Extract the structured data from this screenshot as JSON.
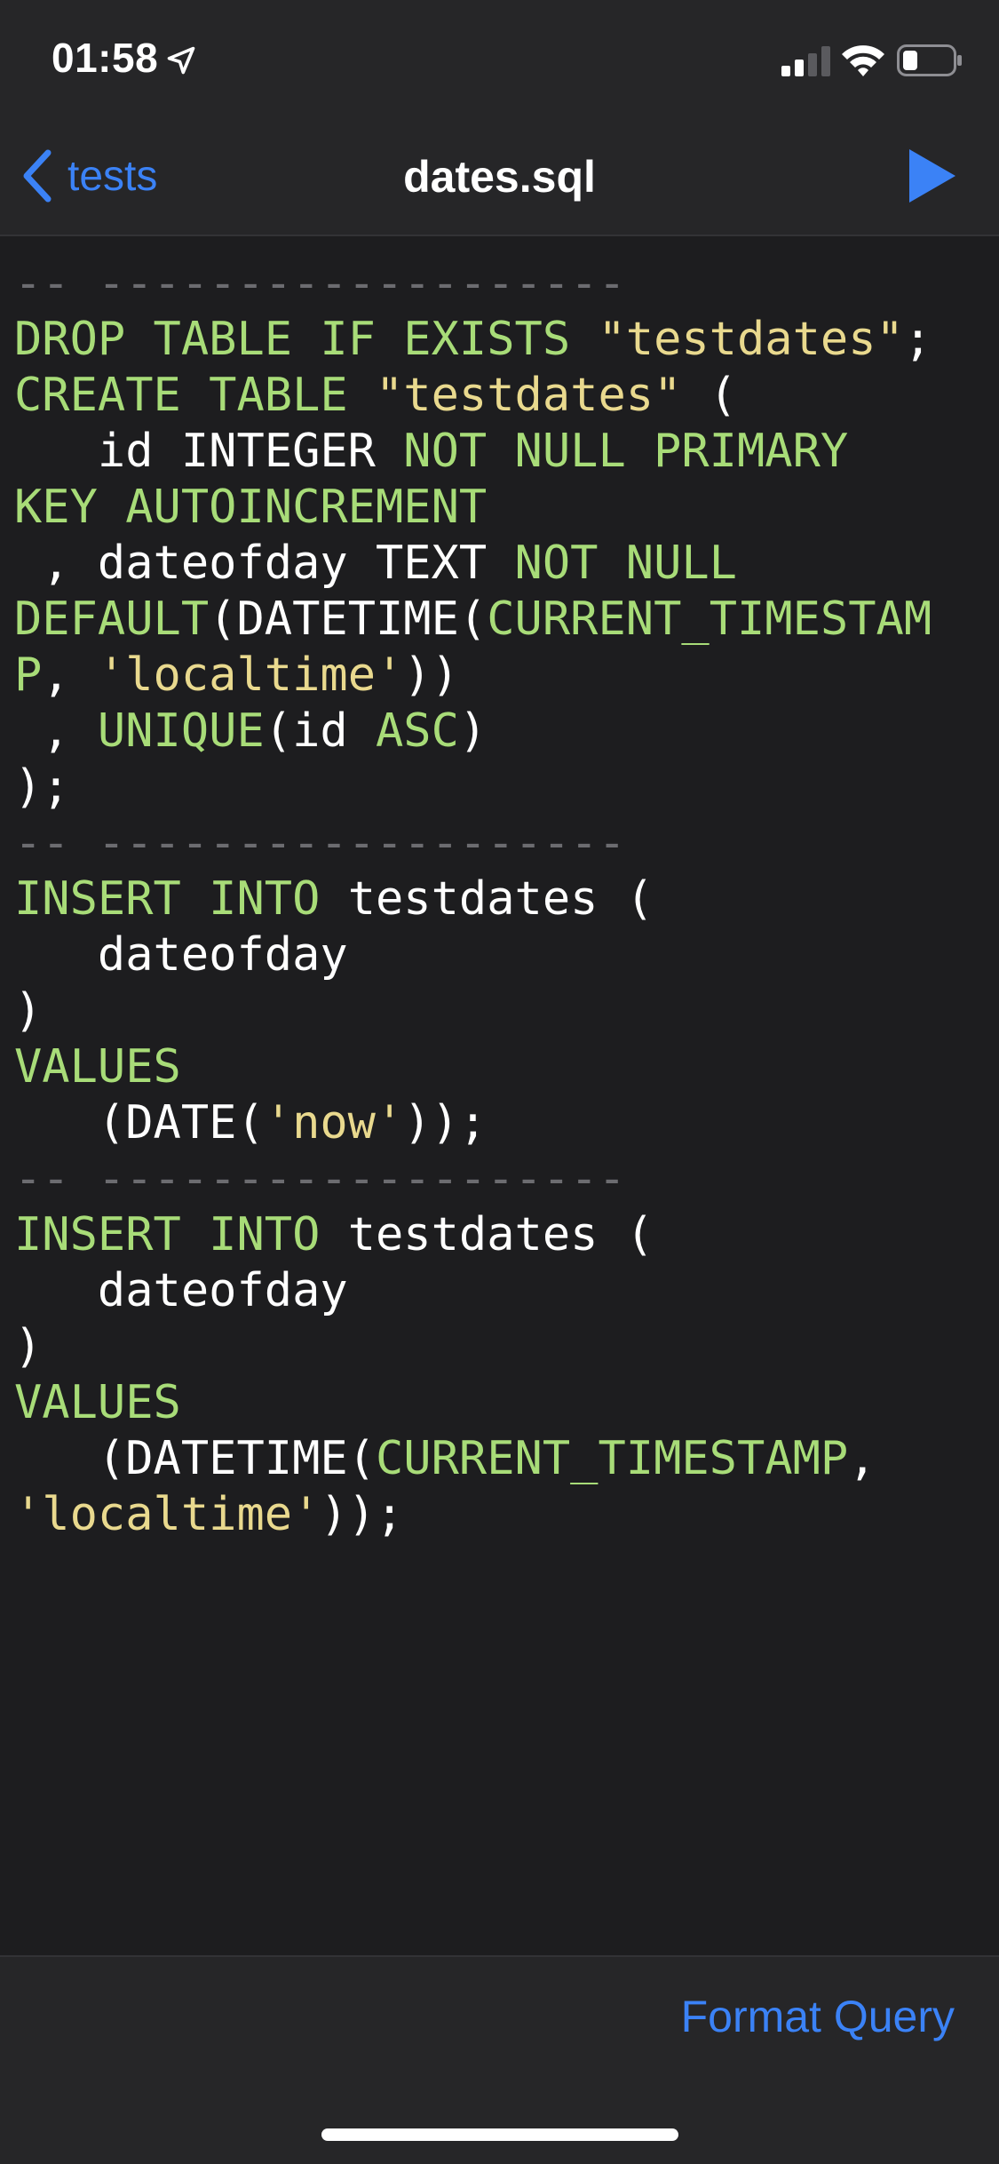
{
  "status_bar": {
    "time": "01:58",
    "location_icon": "location-arrow-icon",
    "signal_icon": "cellular-signal-icon",
    "wifi_icon": "wifi-icon",
    "battery_icon": "battery-low-icon"
  },
  "nav": {
    "back_label": "tests",
    "title": "dates.sql",
    "run_icon": "play-icon"
  },
  "editor": {
    "lines": [
      [
        {
          "t": "cm",
          "v": "-- -------------------"
        }
      ],
      [
        {
          "t": "kw",
          "v": "DROP TABLE IF EXISTS "
        },
        {
          "t": "str",
          "v": "\"testdates\""
        },
        {
          "t": "pl",
          "v": ";"
        }
      ],
      [
        {
          "t": "kw",
          "v": "CREATE TABLE "
        },
        {
          "t": "str",
          "v": "\"testdates\""
        },
        {
          "t": "pl",
          "v": " ("
        }
      ],
      [
        {
          "t": "pl",
          "v": "   id INTEGER "
        },
        {
          "t": "kw",
          "v": "NOT NULL PRIMARY"
        }
      ],
      [
        {
          "t": "kw",
          "v": "KEY AUTOINCREMENT"
        }
      ],
      [
        {
          "t": "pl",
          "v": " , dateofday TEXT "
        },
        {
          "t": "kw",
          "v": "NOT NULL"
        }
      ],
      [
        {
          "t": "kw",
          "v": "DEFAULT"
        },
        {
          "t": "pl",
          "v": "(DATETIME("
        },
        {
          "t": "kw",
          "v": "CURRENT_TIMESTAM"
        }
      ],
      [
        {
          "t": "kw",
          "v": "P"
        },
        {
          "t": "pl",
          "v": ", "
        },
        {
          "t": "str",
          "v": "'localtime'"
        },
        {
          "t": "pl",
          "v": "))"
        }
      ],
      [
        {
          "t": "pl",
          "v": " , "
        },
        {
          "t": "kw",
          "v": "UNIQUE"
        },
        {
          "t": "pl",
          "v": "(id "
        },
        {
          "t": "kw",
          "v": "ASC"
        },
        {
          "t": "pl",
          "v": ")"
        }
      ],
      [
        {
          "t": "pl",
          "v": ");"
        }
      ],
      [
        {
          "t": "cm",
          "v": "-- -------------------"
        }
      ],
      [
        {
          "t": "kw",
          "v": "INSERT INTO "
        },
        {
          "t": "pl",
          "v": "testdates ("
        }
      ],
      [
        {
          "t": "pl",
          "v": "   dateofday"
        }
      ],
      [
        {
          "t": "pl",
          "v": ")"
        }
      ],
      [
        {
          "t": "kw",
          "v": "VALUES"
        }
      ],
      [
        {
          "t": "pl",
          "v": "   (DATE("
        },
        {
          "t": "str",
          "v": "'now'"
        },
        {
          "t": "pl",
          "v": "));"
        }
      ],
      [
        {
          "t": "cm",
          "v": "-- -------------------"
        }
      ],
      [
        {
          "t": "kw",
          "v": "INSERT INTO "
        },
        {
          "t": "pl",
          "v": "testdates ("
        }
      ],
      [
        {
          "t": "pl",
          "v": "   dateofday"
        }
      ],
      [
        {
          "t": "pl",
          "v": ")"
        }
      ],
      [
        {
          "t": "kw",
          "v": "VALUES"
        }
      ],
      [
        {
          "t": "pl",
          "v": "   (DATETIME("
        },
        {
          "t": "kw",
          "v": "CURRENT_TIMESTAMP"
        },
        {
          "t": "pl",
          "v": ","
        }
      ],
      [
        {
          "t": "str",
          "v": "'localtime'"
        },
        {
          "t": "pl",
          "v": "));"
        }
      ]
    ]
  },
  "bottom_bar": {
    "format_label": "Format Query"
  },
  "colors": {
    "accent": "#3b82f6",
    "keyword": "#a8dc78",
    "string": "#e9d98e",
    "comment": "#6c6c70",
    "background": "#1d1d1f"
  }
}
